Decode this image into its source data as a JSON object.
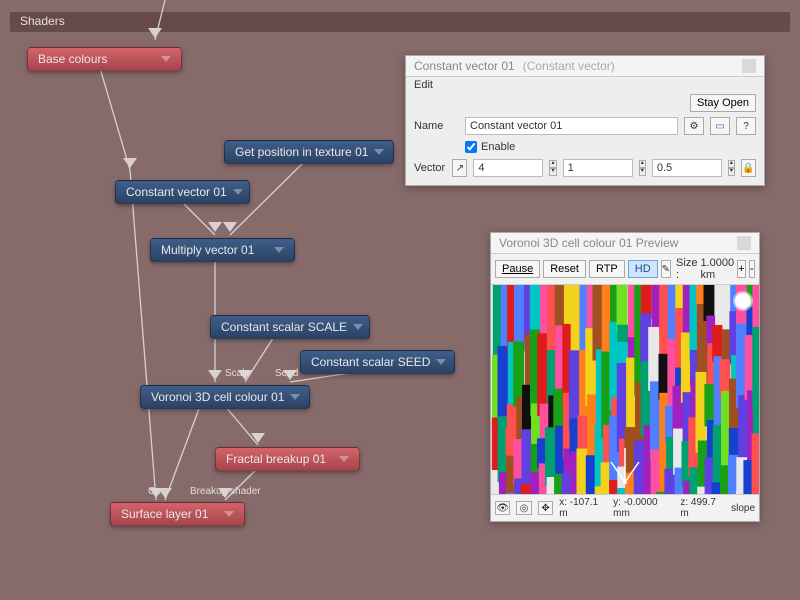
{
  "section_title": "Shaders",
  "nodes": {
    "base_colours": "Base colours",
    "get_position": "Get position in texture 01",
    "constant_vector_01": "Constant vector 01",
    "multiply_vector_01": "Multiply vector 01",
    "constant_scalar_scale": "Constant scalar SCALE",
    "constant_scalar_seed": "Constant scalar SEED",
    "voronoi_cell": "Voronoi 3D cell colour 01",
    "fractal_breakup": "Fractal breakup 01",
    "surface_layer": "Surface layer 01"
  },
  "port_labels": {
    "scale": "Scale",
    "seed": "Seed",
    "co": "Co...",
    "breakup": "Breakup shader"
  },
  "editor_panel": {
    "title": "Constant vector 01",
    "subtitle": "(Constant vector)",
    "menu_edit": "Edit",
    "stay_open": "Stay Open",
    "name_label": "Name",
    "name_value": "Constant vector 01",
    "enable_label": "Enable",
    "vector_label": "Vector",
    "vx": "4",
    "vy": "1",
    "vz": "0.5"
  },
  "preview_panel": {
    "title": "Voronoi 3D cell colour 01 Preview",
    "pause": "Pause",
    "reset": "Reset",
    "rtp": "RTP",
    "hd": "HD",
    "size_label": "Size :",
    "size_value": "1.0000 km",
    "plus": "+",
    "minus": "-",
    "x": "x: -107.1 m",
    "y": "y: -0.0000 mm",
    "z": "z: 499.7 m",
    "slope": "slope"
  }
}
